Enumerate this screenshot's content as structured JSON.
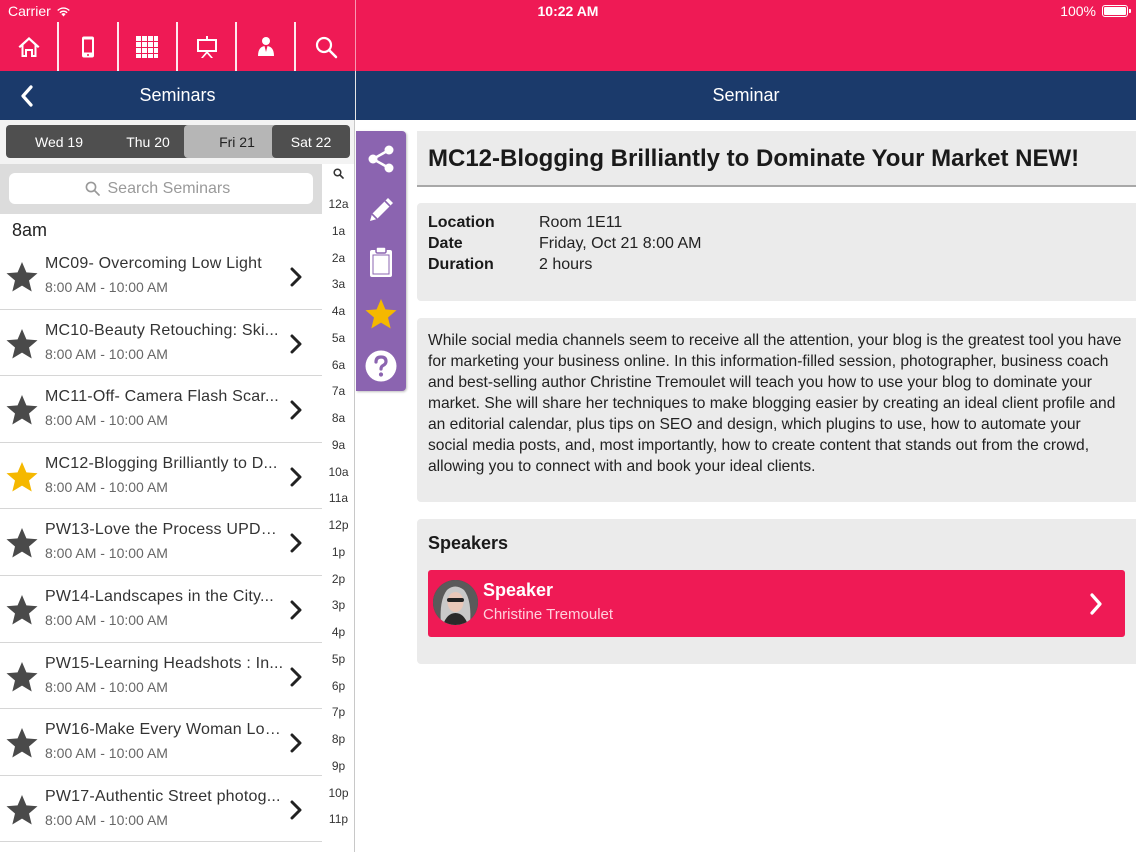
{
  "status": {
    "carrier": "Carrier",
    "time": "10:22 AM",
    "battery": "100%"
  },
  "toolbar": [
    {
      "name": "home-icon"
    },
    {
      "name": "phone-icon"
    },
    {
      "name": "grid-icon"
    },
    {
      "name": "presentation-icon"
    },
    {
      "name": "speaker-icon"
    },
    {
      "name": "search-icon"
    }
  ],
  "nav": {
    "left_title": "Seminars",
    "right_title": "Seminar"
  },
  "days": [
    {
      "label": "Wed 19",
      "active": false
    },
    {
      "label": "Thu 20",
      "active": false
    },
    {
      "label": "Fri 21",
      "active": true
    },
    {
      "label": "Sat 22",
      "active": false
    }
  ],
  "search": {
    "placeholder": "Search Seminars"
  },
  "hour_label": "8am",
  "sessions": [
    {
      "title": "MC09- Overcoming Low Light",
      "time": "8:00 AM - 10:00 AM",
      "favorite": false
    },
    {
      "title": "MC10-Beauty Retouching: Ski...",
      "time": "8:00 AM - 10:00 AM",
      "favorite": false
    },
    {
      "title": "MC11-Off- Camera Flash Scar...",
      "time": "8:00 AM - 10:00 AM",
      "favorite": false
    },
    {
      "title": "MC12-Blogging Brilliantly to D...",
      "time": "8:00 AM - 10:00 AM",
      "favorite": true
    },
    {
      "title": "PW13-Love the Process UPDA...",
      "time": "8:00 AM - 10:00 AM",
      "favorite": false
    },
    {
      "title": "PW14-Landscapes in the City...",
      "time": "8:00 AM - 10:00 AM",
      "favorite": false
    },
    {
      "title": "PW15-Learning Headshots : In...",
      "time": "8:00 AM - 10:00 AM",
      "favorite": false
    },
    {
      "title": "PW16-Make Every Woman Loo...",
      "time": "8:00 AM - 10:00 AM",
      "favorite": false
    },
    {
      "title": "PW17-Authentic Street photog...",
      "time": "8:00 AM - 10:00 AM",
      "favorite": false
    }
  ],
  "index": [
    "12a",
    "1a",
    "2a",
    "3a",
    "4a",
    "5a",
    "6a",
    "7a",
    "8a",
    "9a",
    "10a",
    "11a",
    "12p",
    "1p",
    "2p",
    "3p",
    "4p",
    "5p",
    "6p",
    "7p",
    "8p",
    "9p",
    "10p",
    "11p"
  ],
  "actions": [
    {
      "name": "share-icon"
    },
    {
      "name": "pencil-icon"
    },
    {
      "name": "clipboard-icon"
    },
    {
      "name": "star-icon"
    },
    {
      "name": "help-icon"
    }
  ],
  "detail": {
    "title": "MC12-Blogging Brilliantly to Dominate Your Market NEW!",
    "location_label": "Location",
    "location": "Room 1E11",
    "date_label": "Date",
    "date": "Friday, Oct 21 8:00 AM",
    "duration_label": "Duration",
    "duration": "2 hours",
    "description_lines": [
      "While social media channels seem to receive all the attention, your blog is the greatest tool you have",
      "for marketing your business online. In this information-filled session, photographer, business coach",
      "and best-selling author Christine Tremoulet will teach you how to use your blog to dominate your",
      "market. She will share her techniques to make blogging easier by creating an ideal client profile and",
      "an editorial calendar, plus tips on SEO and design, which plugins to use, how to automate your",
      "social media posts, and, most importantly, how to create content that stands out from the crowd,",
      "allowing you to connect with and book your ideal clients."
    ],
    "speakers_heading": "Speakers",
    "speaker": {
      "role": "Speaker",
      "name": "Christine Tremoulet"
    }
  },
  "colors": {
    "pink": "#ef1a55",
    "navy": "#1b3a6b",
    "purple": "#8b64b0",
    "star_gold": "#f5b800",
    "star_gray": "#4a4a4a"
  }
}
